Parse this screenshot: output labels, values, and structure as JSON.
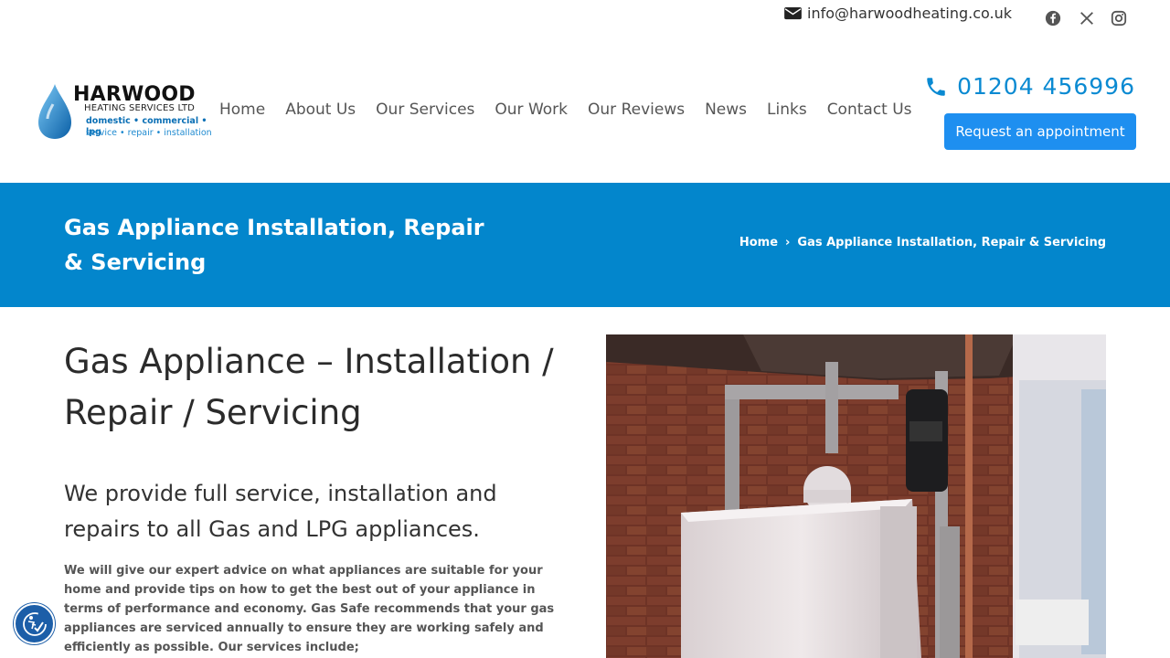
{
  "topbar": {
    "email": "info@harwoodheating.co.uk",
    "social": [
      "facebook-icon",
      "x-icon",
      "instagram-icon"
    ]
  },
  "logo": {
    "brand": "HARWOOD",
    "sub1": "HEATING SERVICES LTD",
    "sub2": "domestic • commercial • lpg",
    "sub3": "service  •  repair • installation"
  },
  "nav": {
    "items": [
      "Home",
      "About Us",
      "Our Services",
      "Our Work",
      "Our Reviews",
      "News",
      "Links",
      "Contact Us"
    ]
  },
  "header": {
    "phone": "01204 456996",
    "cta": "Request an appointment"
  },
  "band": {
    "title": "Gas Appliance Installation, Repair & Servicing",
    "crumb_home": "Home",
    "crumb_current": "Gas Appliance Installation, Repair & Servicing"
  },
  "content": {
    "heading": "Gas Appliance – Installation / Repair / Servicing",
    "lead": "We provide full service, installation and repairs to all Gas and LPG appliances.",
    "body": "We will give our expert advice on what appliances are suitable for your home and provide tips on how to get the best out of your appliance in terms of performance and economy. Gas Safe recommends that your gas appliances are serviced annually to ensure they are working safely and efficiently as possible. Our services include;"
  },
  "colors": {
    "accent": "#0386cc",
    "button": "#1e8ff0",
    "phone": "#0a8ad2"
  }
}
